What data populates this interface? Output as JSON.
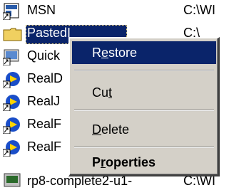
{
  "files": [
    {
      "name": "MSN",
      "path": "C:\\WI",
      "icon": "shortcut-icon"
    },
    {
      "name": "PastedI",
      "path": "C:\\",
      "icon": "folder-icon",
      "selected": true
    },
    {
      "name": "Quick",
      "path": "",
      "icon": "quicktime-icon"
    },
    {
      "name": "RealD",
      "path": "",
      "icon": "realplayer-icon"
    },
    {
      "name": "RealJ",
      "path": "",
      "icon": "realplayer-icon"
    },
    {
      "name": "RealF",
      "path": "",
      "icon": "realplayer-icon"
    },
    {
      "name": "RealF",
      "path": "",
      "icon": "realplayer-icon"
    },
    {
      "name": "rp8-complete2-u1-",
      "path": "C:\\WI",
      "icon": "installer-icon"
    }
  ],
  "context_menu": {
    "items": [
      {
        "pre": "R",
        "u": "e",
        "post": "store",
        "highlight": true
      },
      {
        "pre": "Cu",
        "u": "t",
        "post": ""
      },
      {
        "pre": "",
        "u": "D",
        "post": "elete"
      },
      {
        "pre": "P",
        "u": "r",
        "post": "operties",
        "bold": true
      }
    ]
  },
  "colors": {
    "selection": "#0a246a",
    "menu_bg": "#d4d0c8",
    "folder": "#f0d060"
  }
}
